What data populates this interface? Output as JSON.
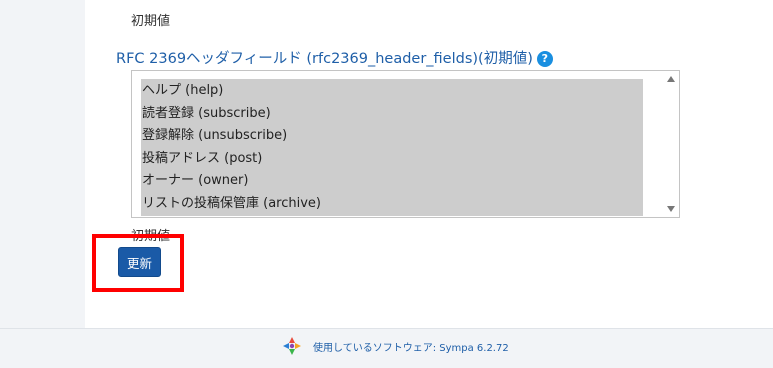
{
  "section": {
    "default_label_top": "初期値",
    "field_label": "RFC 2369ヘッダフィールド (rfc2369_header_fields)(初期値)",
    "help_icon": "?",
    "options": [
      "ヘルプ (help)",
      "読者登録 (subscribe)",
      "登録解除 (unsubscribe)",
      "投稿アドレス (post)",
      "オーナー (owner)",
      "リストの投稿保管庫 (archive)"
    ],
    "default_label_bottom": "初期値",
    "update_button": "更新"
  },
  "footer": {
    "text": "使用しているソフトウェア: Sympa 6.2.72",
    "logo_icon": "sympa-logo-icon"
  },
  "colors": {
    "link": "#1f5fa8",
    "button": "#1a5aa7",
    "highlight": "#ff0000",
    "selected_bg": "#cdcdcd"
  }
}
